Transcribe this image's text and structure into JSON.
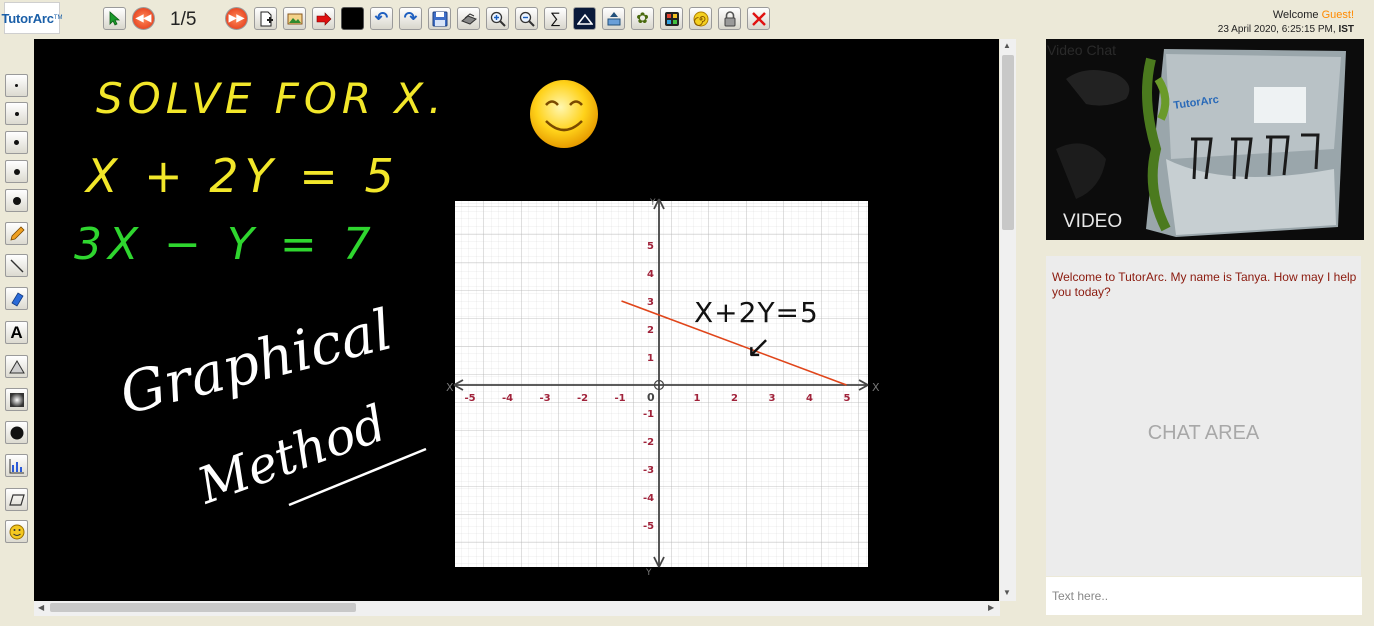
{
  "header": {
    "logo": "TutorArc",
    "logo_tm": "TM",
    "page_indicator": "1/5",
    "welcome": "Welcome",
    "user": "Guest!",
    "datetime": "23 April 2020, 6:25:15 PM,",
    "timezone": "IST"
  },
  "toolbar": {
    "icons": [
      "select-arrow-icon",
      "previous-page-icon",
      "next-page-icon",
      "new-page-icon",
      "insert-image-icon",
      "arrow-icon",
      "color-swatch-icon",
      "undo-icon",
      "redo-icon",
      "save-icon",
      "print-icon",
      "zoom-in-icon",
      "zoom-out-icon",
      "equation-icon",
      "mountain-image-icon",
      "upload-icon",
      "leaf-icon",
      "grid-icon",
      "spiral-icon",
      "lock-icon",
      "close-icon"
    ],
    "color_swatch": "#000000"
  },
  "left_tools": {
    "icons": [
      "pen-size-1-icon",
      "pen-size-2-icon",
      "pen-size-3-icon",
      "pen-size-4-icon",
      "pen-size-5-icon",
      "pencil-icon",
      "line-icon",
      "highlighter-icon",
      "text-icon",
      "triangle-icon",
      "shade-icon",
      "fill-color-icon",
      "bar-chart-icon",
      "parallelogram-icon",
      "emoji-icon"
    ],
    "text_label": "A"
  },
  "board": {
    "heading": "SOLVE FOR X.",
    "eq1": "X + 2Y = 5",
    "eq2": "3X − Y = 7",
    "note_line1": "Graphical",
    "note_line2": "Method",
    "emoji": "😊",
    "graph_label": "X+2Y=5",
    "graph_arrow": "↙",
    "x_axis_name": "X",
    "y_axis_name": "Y",
    "x_ticks": [
      "-5",
      "-4",
      "-3",
      "-2",
      "-1",
      "1",
      "2",
      "3",
      "4",
      "5"
    ],
    "y_ticks": [
      "5",
      "4",
      "3",
      "2",
      "1",
      "-1",
      "-2",
      "-3",
      "-4",
      "-5"
    ],
    "origin": "0",
    "line_color": "#e0451a",
    "ink_yellow": "#f2e72a",
    "ink_green": "#2fd62f",
    "ink_white": "#ffffff"
  },
  "video": {
    "title": "Video Chat",
    "label": "VIDEO"
  },
  "chat": {
    "message": "Welcome to TutorArc. My name is Tanya. How may I help you today?",
    "area_label": "CHAT AREA",
    "placeholder": "Text here.."
  }
}
